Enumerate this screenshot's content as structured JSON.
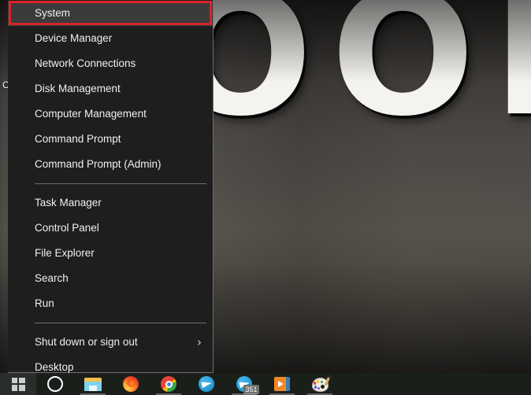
{
  "desktop": {
    "wallpaper_sign_letters": [
      "O",
      "O",
      "N"
    ],
    "cut_off_icon_label": "C",
    "wallpaper_base_color": "#4b4845"
  },
  "menu": {
    "name": "Win+X Quick Link Menu",
    "background_color": "#1e1e1e",
    "highlight_color": "#3b3b3b",
    "annotation_box_color": "#d8232a",
    "groups": [
      {
        "items": [
          {
            "label": "System",
            "highlighted": true,
            "submenu": false
          },
          {
            "label": "Device Manager",
            "highlighted": false,
            "submenu": false
          },
          {
            "label": "Network Connections",
            "highlighted": false,
            "submenu": false
          },
          {
            "label": "Disk Management",
            "highlighted": false,
            "submenu": false
          },
          {
            "label": "Computer Management",
            "highlighted": false,
            "submenu": false
          },
          {
            "label": "Command Prompt",
            "highlighted": false,
            "submenu": false
          },
          {
            "label": "Command Prompt (Admin)",
            "highlighted": false,
            "submenu": false
          }
        ]
      },
      {
        "items": [
          {
            "label": "Task Manager",
            "highlighted": false,
            "submenu": false
          },
          {
            "label": "Control Panel",
            "highlighted": false,
            "submenu": false
          },
          {
            "label": "File Explorer",
            "highlighted": false,
            "submenu": false
          },
          {
            "label": "Search",
            "highlighted": false,
            "submenu": false
          },
          {
            "label": "Run",
            "highlighted": false,
            "submenu": false
          }
        ]
      },
      {
        "items": [
          {
            "label": "Shut down or sign out",
            "highlighted": false,
            "submenu": true,
            "submenu_glyph": "›"
          },
          {
            "label": "Desktop",
            "highlighted": false,
            "submenu": false
          }
        ]
      }
    ]
  },
  "taskbar": {
    "background_color": "#1a1f1a",
    "start_button": {
      "name": "Start",
      "icon": "windows-logo-icon"
    },
    "buttons": [
      {
        "name": "Cortana",
        "icon": "cortana-circle-icon",
        "running": false,
        "badge": ""
      },
      {
        "name": "File Explorer",
        "icon": "file-explorer-icon",
        "running": true,
        "badge": ""
      },
      {
        "name": "Mozilla Firefox",
        "icon": "firefox-icon",
        "running": false,
        "badge": ""
      },
      {
        "name": "Google Chrome",
        "icon": "chrome-icon",
        "running": true,
        "badge": ""
      },
      {
        "name": "Telegram",
        "icon": "telegram-icon",
        "running": false,
        "badge": ""
      },
      {
        "name": "Telegram Desktop",
        "icon": "telegram-icon",
        "running": true,
        "badge": "351"
      },
      {
        "name": "Movies & TV",
        "icon": "media-player-icon",
        "running": true,
        "badge": ""
      },
      {
        "name": "Paint",
        "icon": "paint-palette-icon",
        "running": true,
        "badge": ""
      }
    ]
  }
}
